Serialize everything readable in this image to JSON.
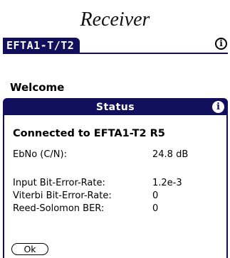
{
  "caption": "Receiver",
  "app": {
    "title": "EFTA1-T/T2",
    "info_glyph": "i",
    "welcome": "Welcome"
  },
  "dialog": {
    "title": "Status",
    "info_glyph": "i",
    "connected": "Connected to EFTA1-T2 R5",
    "rows": [
      {
        "label": "EbNo (C/N):",
        "value": "24.8 dB"
      },
      {
        "label": "Input Bit-Error-Rate:",
        "value": "1.2e-3"
      },
      {
        "label": "Viterbi Bit-Error-Rate:",
        "value": "0"
      },
      {
        "label": "Reed-Solomon BER:",
        "value": "0"
      }
    ],
    "ok_label": "Ok"
  },
  "colors": {
    "title_bar": "#12105c",
    "background": "#ffffff",
    "text": "#000000"
  },
  "icons": {
    "app_info": "info-icon",
    "dialog_info": "info-icon"
  }
}
